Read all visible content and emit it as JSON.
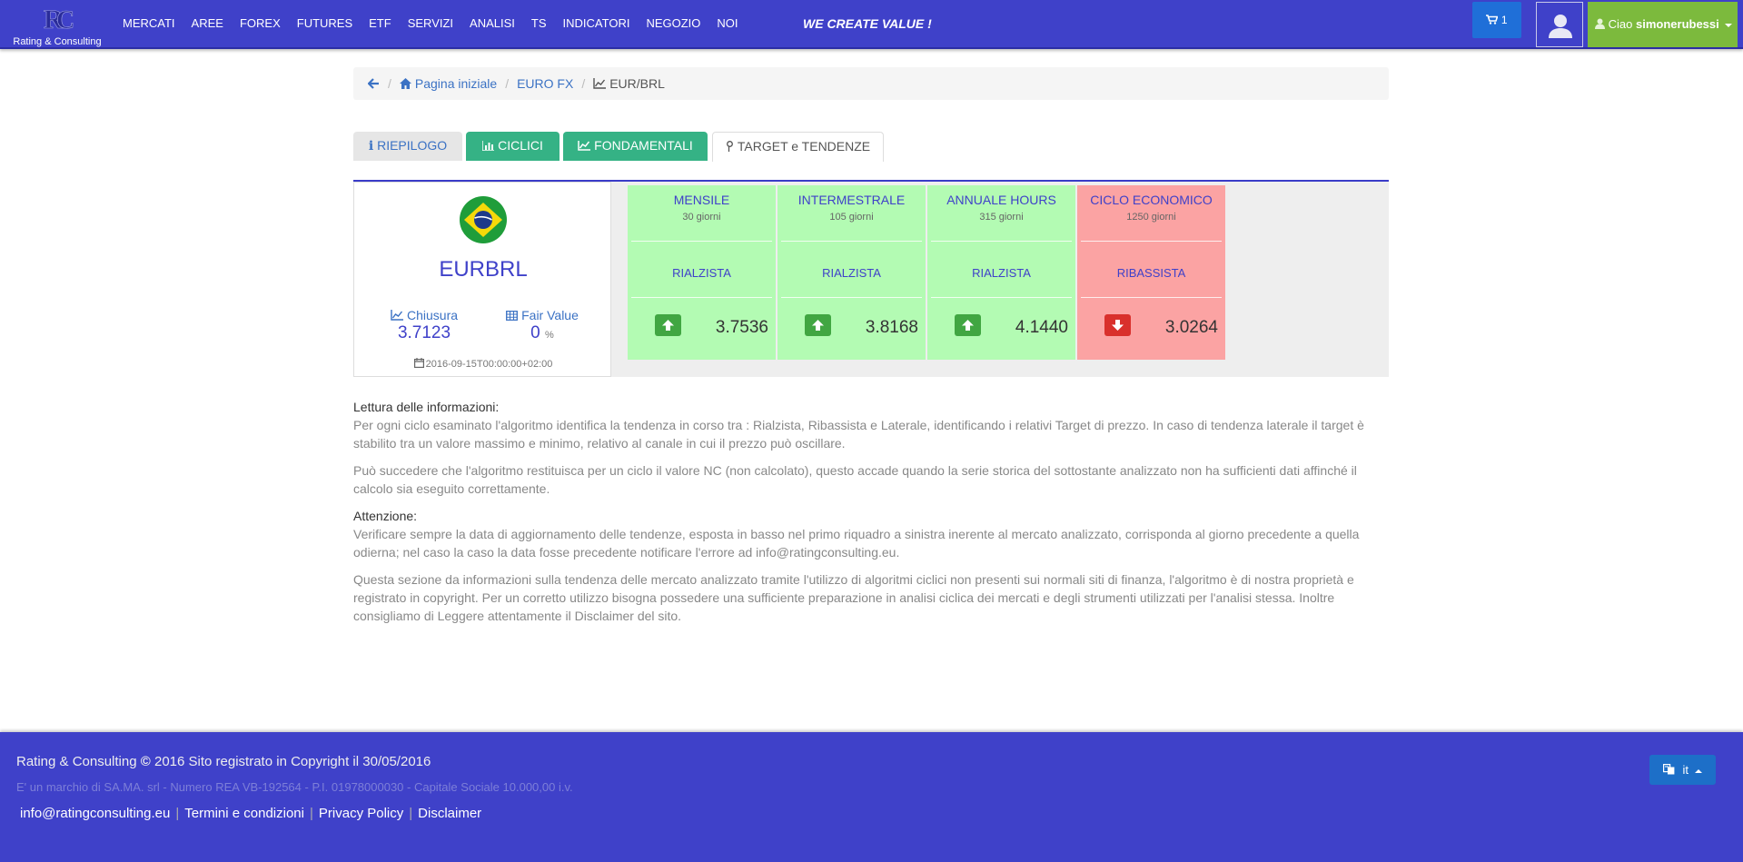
{
  "header": {
    "brand": "Rating & Consulting",
    "menu": [
      "MERCATI",
      "AREE",
      "FOREX",
      "FUTURES",
      "ETF",
      "SERVIZI",
      "ANALISI",
      "TS",
      "INDICATORI",
      "NEGOZIO",
      "NOI"
    ],
    "slogan": "WE CREATE VALUE !",
    "cart_count": "1",
    "greeting": "Ciao",
    "username": "simonerubessi"
  },
  "breadcrumb": {
    "home": "Pagina iniziale",
    "section": "EURO FX",
    "current": "EUR/BRL"
  },
  "tabs": [
    "RIEPILOGO",
    "CICLICI",
    "FONDAMENTALI",
    "TARGET e TENDENZE"
  ],
  "summary": {
    "symbol": "EURBRL",
    "close_label": "Chiusura",
    "close_value": "3.7123",
    "fair_label": "Fair Value",
    "fair_value": "0",
    "fair_unit": "%",
    "date": "2016-09-15T00:00:00+02:00"
  },
  "cycles": [
    {
      "title": "MENSILE",
      "days": "30 giorni",
      "trend": "RIALZISTA",
      "direction": "up",
      "value": "3.7536"
    },
    {
      "title": "INTERMESTRALE",
      "days": "105 giorni",
      "trend": "RIALZISTA",
      "direction": "up",
      "value": "3.8168"
    },
    {
      "title": "ANNUALE HOURS",
      "days": "315 giorni",
      "trend": "RIALZISTA",
      "direction": "up",
      "value": "4.1440"
    },
    {
      "title": "CICLO ECONOMICO",
      "days": "1250 giorni",
      "trend": "RIBASSISTA",
      "direction": "down",
      "value": "3.0264"
    }
  ],
  "info": {
    "heading1": "Lettura delle informazioni:",
    "p1": "Per ogni ciclo esaminato l'algoritmo identifica la tendenza in corso tra : Rialzista, Ribassista e Laterale, identificando i relativi Target di prezzo. In caso di tendenza laterale il target è stabilito tra un valore massimo e minimo, relativo al canale in cui il prezzo può oscillare.",
    "p2": "Può succedere che l'algoritmo restituisca per un ciclo il valore NC (non calcolato), questo accade quando la serie storica del sottostante analizzato non ha sufficienti dati affinché il calcolo sia eseguito correttamente.",
    "heading2": "Attenzione:",
    "p3": "Verificare sempre la data di aggiornamento delle tendenze, esposta in basso nel primo riquadro a sinistra inerente al mercato analizzato, corrisponda al giorno precedente a quella odierna; nel caso la caso la data fosse precedente notificare l'errore ad info@ratingconsulting.eu.",
    "p4": "Questa sezione da informazioni sulla tendenza delle mercato analizzato tramite l'utilizzo di algoritmi ciclici non presenti sui normali siti di finanza, l'algoritmo è di nostra proprietà e registrato in copyright. Per un corretto utilizzo bisogna possedere una sufficiente preparazione in analisi ciclica dei mercati e degli strumenti utilizzati per l'analisi stessa. Inoltre consigliamo di Leggere attentamente il Disclaimer del sito."
  },
  "footer": {
    "brand": "Rating & Consulting",
    "copyright": "2016 Sito registrato in Copyright il 30/05/2016",
    "legal": "E' un marchio di SA.MA. srl - Numero REA VB-192564 - P.I. 01978000030 - Capitale Sociale 10.000,00 i.v.",
    "links": [
      "info@ratingconsulting.eu",
      "Termini e condizioni",
      "Privacy Policy",
      "Disclaimer"
    ],
    "language": "it"
  },
  "colors": {
    "navbar": "#3f41c9",
    "bull": "#b3fbb3",
    "bear": "#fba3a3",
    "tab_green": "#35b285"
  }
}
